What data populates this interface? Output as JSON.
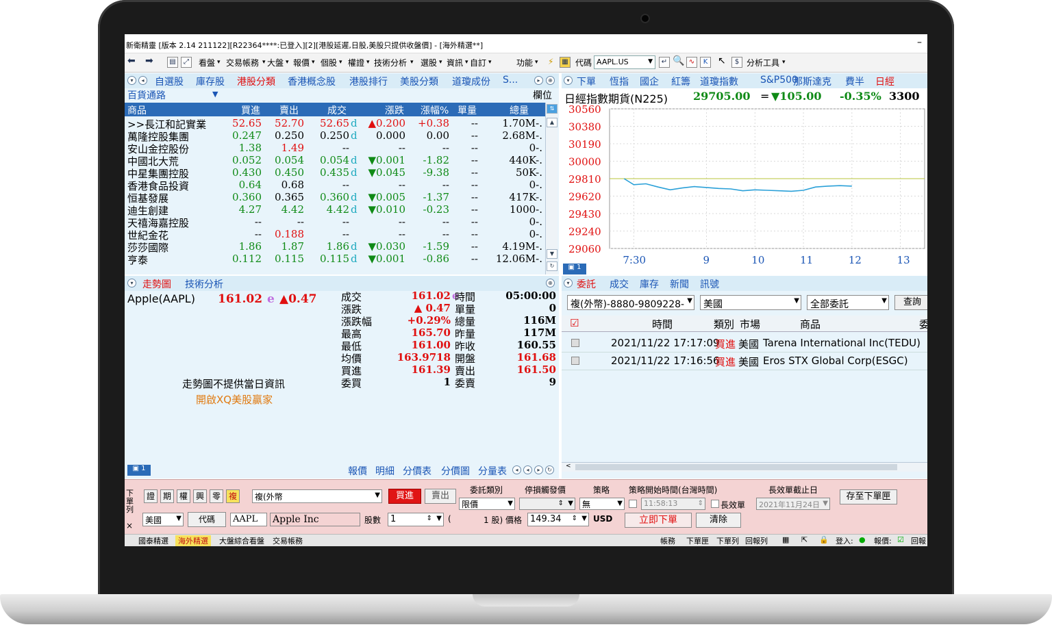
{
  "window": {
    "title": "新衛精靈 [版本 2.14 211122][R22364****:已登入][2][港股延遲,日股,美股只提供收盤價] - [海外精選**]",
    "minimize": "–"
  },
  "toolbar": {
    "items": [
      "看盤",
      "交易帳務",
      "大盤",
      "報價",
      "個股",
      "權證",
      "技術分析",
      "選股",
      "資訊",
      "自訂",
      "功能"
    ],
    "code_label": "代碼",
    "code_value": "AAPL.US",
    "analysis": "分析工具"
  },
  "watchlist": {
    "tabs": [
      "自選股",
      "庫存股",
      "港股分類",
      "香港概念股",
      "港股排行",
      "美股分類",
      "道瓊成份",
      "S..."
    ],
    "active_tab": "港股分類",
    "subcategory": "百貨通路",
    "field_button": "欄位",
    "columns": [
      "商品",
      "買進",
      "賣出",
      "成交",
      "漲跌",
      "漲幅%",
      "單量",
      "總量"
    ],
    "rows": [
      {
        "name": ">>長江和記實業",
        "bid": "52.65",
        "ask": "52.70",
        "last": "52.65",
        "flag": "d",
        "chg": "▲0.200",
        "pct": "+0.38",
        "vol": "--",
        "total": "1.70M-.",
        "c": "red"
      },
      {
        "name": "萬隆控股集團",
        "bid": "0.247",
        "ask": "0.250",
        "last": "0.250",
        "flag": "d",
        "chg": "0.000",
        "pct": "0.00",
        "vol": "--",
        "total": "2.68M-.",
        "c": "blk"
      },
      {
        "name": "安山金控股份",
        "bid": "1.38",
        "ask": "1.49",
        "last": "--",
        "flag": "",
        "chg": "--",
        "pct": "--",
        "vol": "--",
        "total": "0-.",
        "c": "blk"
      },
      {
        "name": "中國北大荒",
        "bid": "0.052",
        "ask": "0.054",
        "last": "0.054",
        "flag": "d",
        "chg": "▼0.001",
        "pct": "-1.82",
        "vol": "--",
        "total": "440K-.",
        "c": "grn"
      },
      {
        "name": "中星集團控股",
        "bid": "0.430",
        "ask": "0.450",
        "last": "0.435",
        "flag": "d",
        "chg": "▼0.045",
        "pct": "-9.38",
        "vol": "--",
        "total": "50K-.",
        "c": "grn"
      },
      {
        "name": "香港食品投資",
        "bid": "0.64",
        "ask": "0.68",
        "last": "--",
        "flag": "",
        "chg": "--",
        "pct": "--",
        "vol": "--",
        "total": "0-.",
        "c": "blk"
      },
      {
        "name": "恒基發展",
        "bid": "0.360",
        "ask": "0.365",
        "last": "0.360",
        "flag": "d",
        "chg": "▼0.005",
        "pct": "-1.37",
        "vol": "--",
        "total": "417K-.",
        "c": "grn"
      },
      {
        "name": "迪生創建",
        "bid": "4.27",
        "ask": "4.42",
        "last": "4.42",
        "flag": "d",
        "chg": "▼0.010",
        "pct": "-0.23",
        "vol": "--",
        "total": "1000-.",
        "c": "grn"
      },
      {
        "name": "天禧海嘉控股",
        "bid": "--",
        "ask": "--",
        "last": "--",
        "flag": "",
        "chg": "--",
        "pct": "--",
        "vol": "--",
        "total": "0-.",
        "c": "blk"
      },
      {
        "name": "世紀金花",
        "bid": "--",
        "ask": "0.188",
        "last": "--",
        "flag": "",
        "chg": "--",
        "pct": "--",
        "vol": "--",
        "total": "0-.",
        "c": "blk"
      },
      {
        "name": "莎莎國際",
        "bid": "1.86",
        "ask": "1.87",
        "last": "1.86",
        "flag": "d",
        "chg": "▼0.030",
        "pct": "-1.59",
        "vol": "--",
        "total": "4.19M-.",
        "c": "grn"
      },
      {
        "name": "亨泰",
        "bid": "0.112",
        "ask": "0.115",
        "last": "0.115",
        "flag": "d",
        "chg": "▼0.001",
        "pct": "-0.86",
        "vol": "--",
        "total": "12.06M-.",
        "c": "grn"
      }
    ]
  },
  "index_panel": {
    "tabs": [
      "下單",
      "恆指",
      "國企",
      "紅籌",
      "道瓊指數",
      "S&P500",
      "那斯達克",
      "費半",
      "日經"
    ],
    "active_tab": "日經",
    "name": "日經指數期貨(N225)",
    "price": "29705.00",
    "eq": "=",
    "change": "▼105.00",
    "pct": "-0.35%",
    "volume": "3300"
  },
  "chart_data": {
    "type": "line",
    "title": "日經指數期貨(N225)",
    "ylim": [
      29060,
      30560
    ],
    "y_ticks": [
      "30560",
      "30380",
      "30190",
      "30000",
      "29810",
      "29620",
      "29430",
      "29240",
      "29060"
    ],
    "x_ticks": [
      "7:30",
      "9",
      "10",
      "11",
      "12",
      "13"
    ],
    "reference": 29810,
    "x": [
      7.3,
      7.5,
      7.75,
      8.0,
      8.25,
      8.5,
      8.75,
      9.0,
      9.25,
      9.5,
      9.75,
      10.0,
      10.25,
      10.5,
      10.75,
      11.0,
      11.25,
      11.5,
      11.75,
      12.0
    ],
    "values": [
      29810,
      29745,
      29755,
      29720,
      29690,
      29710,
      29725,
      29715,
      29705,
      29700,
      29680,
      29690,
      29685,
      29680,
      29675,
      29685,
      29720,
      29730,
      29735,
      29730
    ],
    "colors": {
      "line": "#2aa0d8",
      "reference": "#b8c43a",
      "grid": "#d9d9d9"
    }
  },
  "quote_panel": {
    "tabs": [
      "走勢圖",
      "技術分析"
    ],
    "active_tab": "走勢圖",
    "symbol": "Apple(AAPL)",
    "price": "161.02",
    "flag": "e",
    "change": "▲0.47",
    "no_data": "走勢圖不提供當日資訊",
    "promo": "開啟XQ美股贏家",
    "fields_left": [
      {
        "label": "成交",
        "value": "161.02",
        "flag": "e",
        "c": "red"
      },
      {
        "label": "漲跌",
        "value": "▲ 0.47",
        "flag": "",
        "c": "red"
      },
      {
        "label": "漲跌幅",
        "value": "+0.29%",
        "flag": "",
        "c": "red"
      },
      {
        "label": "最高",
        "value": "165.70",
        "flag": "",
        "c": "red"
      },
      {
        "label": "最低",
        "value": "161.00",
        "flag": "",
        "c": "red"
      },
      {
        "label": "均價",
        "value": "163.9718",
        "flag": "",
        "c": "red"
      },
      {
        "label": "買進",
        "value": "161.39",
        "flag": "",
        "c": "red"
      },
      {
        "label": "委買",
        "value": "1",
        "flag": "",
        "c": "blk"
      }
    ],
    "fields_right": [
      {
        "label": "時間",
        "value": "05:00:00",
        "c": "blk"
      },
      {
        "label": "單量",
        "value": "0",
        "c": "blk"
      },
      {
        "label": "總量",
        "value": "116M",
        "c": "blk"
      },
      {
        "label": "昨量",
        "value": "117M",
        "c": "blk"
      },
      {
        "label": "昨收",
        "value": "160.55",
        "c": "blk"
      },
      {
        "label": "開盤",
        "value": "161.68",
        "c": "red"
      },
      {
        "label": "賣出",
        "value": "161.50",
        "c": "red"
      },
      {
        "label": "委賣",
        "value": "9",
        "c": "blk"
      }
    ],
    "bottom_tabs": [
      "報價",
      "明細",
      "分價表",
      "分價圖",
      "分量表"
    ]
  },
  "orders_panel": {
    "tabs": [
      "委託",
      "成交",
      "庫存",
      "新聞",
      "訊號"
    ],
    "active_tab": "委託",
    "account": "複(外幣)-8880-9809228-",
    "market": "美國",
    "filter": "全部委託",
    "query": "查詢",
    "columns": [
      "時間",
      "類別",
      "市場",
      "商品",
      "委"
    ],
    "rows": [
      {
        "time": "2021/11/22 17:17:09",
        "type": "買進",
        "market": "美國",
        "product": "Tarena International Inc(TEDU)"
      },
      {
        "time": "2021/11/22 17:16:56",
        "type": "買進",
        "market": "美國",
        "product": "Eros STX Global Corp(ESGC)"
      }
    ]
  },
  "order_entry": {
    "side_label": "下單列",
    "close": "×",
    "types": [
      "證",
      "期",
      "權",
      "興",
      "零",
      "複"
    ],
    "active_type": "複",
    "account": "複(外幣",
    "buy": "買進",
    "sell": "賣出",
    "market": "美國",
    "code_btn": "代碼",
    "code": "AAPL",
    "name": "Apple Inc",
    "shares_label": "股數",
    "shares": "1",
    "paren_open": "(",
    "lot": "1 股) 價格",
    "price": "149.34",
    "currency": "USD",
    "order_type_label": "委託類別",
    "order_type": "限價",
    "stop_label": "停損觸發價",
    "strategy_label": "策略",
    "strategy": "無",
    "start_label": "策略開始時間(台灣時間)",
    "start_time": "11:58:13",
    "long_label": "長效單",
    "expiry_label": "長效單截止日",
    "expiry": "2021年11月24日",
    "submit": "立即下單",
    "clear": "清除",
    "save": "存至下單匣"
  },
  "status": {
    "tabs": [
      "國泰精選",
      "海外精選",
      "大盤綜合看盤",
      "交易帳務"
    ],
    "active_tab": "海外精選",
    "right": [
      "帳務",
      "下單匣",
      "下單列",
      "回報列"
    ],
    "login": "登入:",
    "quote": "報價:",
    "more": "回報"
  }
}
